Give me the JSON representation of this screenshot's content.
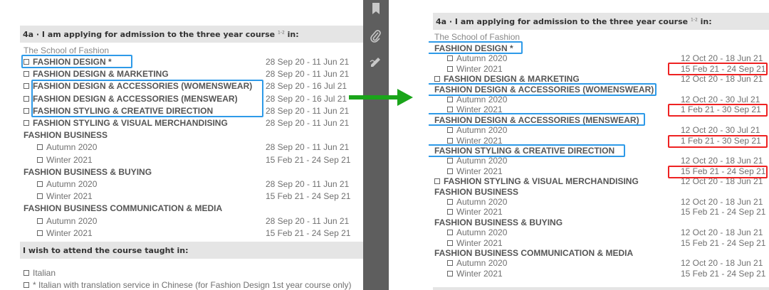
{
  "left": {
    "header": {
      "title": "4a · I am applying for admission to the three year course",
      "sup": "1-2",
      "suffix": " in:"
    },
    "school": "The School of Fashion",
    "rows": [
      {
        "text": "FASHION DESIGN *",
        "date": "28 Sep 20 - 11 Jun 21",
        "checkbox": true,
        "bold": true
      },
      {
        "text": "FASHION DESIGN & MARKETING",
        "date": "28 Sep 20 - 11 Jun 21",
        "checkbox": true,
        "bold": true
      },
      {
        "text": "FASHION DESIGN & ACCESSORIES (WOMENSWEAR)",
        "date": "28 Sep 20 - 16 Jul 21",
        "checkbox": true,
        "bold": true
      },
      {
        "text": "FASHION DESIGN & ACCESSORIES (MENSWEAR)",
        "date": "28 Sep 20 - 16 Jul 21",
        "checkbox": true,
        "bold": true
      },
      {
        "text": "FASHION STYLING & CREATIVE DIRECTION",
        "date": "28 Sep 20 - 11 Jun 21",
        "checkbox": true,
        "bold": true
      },
      {
        "text": "FASHION STYLING & VISUAL MERCHANDISING",
        "date": "28 Sep 20 - 11 Jun 21",
        "checkbox": true,
        "bold": true
      },
      {
        "text": "FASHION BUSINESS",
        "date": "",
        "checkbox": false,
        "bold": true
      },
      {
        "text": "Autumn 2020",
        "date": "28 Sep 20 - 11 Jun 21",
        "checkbox": true,
        "bold": false,
        "indent": true
      },
      {
        "text": "Winter 2021",
        "date": "15 Feb 21 - 24 Sep 21",
        "checkbox": true,
        "bold": false,
        "indent": true
      },
      {
        "text": "FASHION BUSINESS & BUYING",
        "date": "",
        "checkbox": false,
        "bold": true
      },
      {
        "text": "Autumn 2020",
        "date": "28 Sep 20 - 11 Jun 21",
        "checkbox": true,
        "bold": false,
        "indent": true
      },
      {
        "text": "Winter 2021",
        "date": "15 Feb 21 - 24 Sep 21",
        "checkbox": true,
        "bold": false,
        "indent": true
      },
      {
        "text": "FASHION BUSINESS COMMUNICATION & MEDIA",
        "date": "",
        "checkbox": false,
        "bold": true
      },
      {
        "text": "Autumn 2020",
        "date": "28 Sep 20 - 11 Jun 21",
        "checkbox": true,
        "bold": false,
        "indent": true
      },
      {
        "text": "Winter 2021",
        "date": "15 Feb 21 - 24 Sep 21",
        "checkbox": true,
        "bold": false,
        "indent": true
      }
    ],
    "header2": "I wish to attend the course taught in:",
    "options": [
      "Italian",
      "* Italian with translation service in Chinese (for Fashion Design 1st year course only)"
    ]
  },
  "right": {
    "header": {
      "title": "4a · I am applying for admission to the three year course",
      "sup": "1-2",
      "suffix": " in:"
    },
    "school": "The School of Fashion",
    "rows": [
      {
        "text": "FASHION DESIGN *",
        "date": "",
        "checkbox": false,
        "bold": true
      },
      {
        "text": "Autumn 2020",
        "date": "12 Oct 20 - 18 Jun 21",
        "checkbox": true,
        "bold": false,
        "indent": true
      },
      {
        "text": "Winter 2021",
        "date": "15 Feb 21 - 24 Sep 21",
        "checkbox": true,
        "bold": false,
        "indent": true
      },
      {
        "text": "FASHION DESIGN & MARKETING",
        "date": "12 Oct 20 - 18 Jun 21",
        "checkbox": true,
        "bold": true
      },
      {
        "text": "FASHION DESIGN & ACCESSORIES (WOMENSWEAR)",
        "date": "",
        "checkbox": false,
        "bold": true
      },
      {
        "text": "Autumn 2020",
        "date": "12 Oct 20 - 30 Jul 21",
        "checkbox": true,
        "bold": false,
        "indent": true
      },
      {
        "text": "Winter 2021",
        "date": "1 Feb 21 - 30 Sep 21",
        "checkbox": true,
        "bold": false,
        "indent": true
      },
      {
        "text": "FASHION DESIGN & ACCESSORIES (MENSWEAR)",
        "date": "",
        "checkbox": false,
        "bold": true
      },
      {
        "text": "Autumn 2020",
        "date": "12 Oct 20 - 30 Jul 21",
        "checkbox": true,
        "bold": false,
        "indent": true
      },
      {
        "text": "Winter 2021",
        "date": "1 Feb 21 - 30 Sep 21",
        "checkbox": true,
        "bold": false,
        "indent": true
      },
      {
        "text": "FASHION STYLING & CREATIVE DIRECTION",
        "date": "",
        "checkbox": false,
        "bold": true
      },
      {
        "text": "Autumn 2020",
        "date": "12 Oct 20 - 18 Jun 21",
        "checkbox": true,
        "bold": false,
        "indent": true
      },
      {
        "text": "Winter 2021",
        "date": "15 Feb 21 - 24 Sep 21",
        "checkbox": true,
        "bold": false,
        "indent": true
      },
      {
        "text": "FASHION STYLING & VISUAL MERCHANDISING",
        "date": "12 Oct 20 - 18 Jun 21",
        "checkbox": true,
        "bold": true
      },
      {
        "text": "FASHION BUSINESS",
        "date": "",
        "checkbox": false,
        "bold": true
      },
      {
        "text": "Autumn 2020",
        "date": "12 Oct 20 - 18 Jun 21",
        "checkbox": true,
        "bold": false,
        "indent": true
      },
      {
        "text": "Winter 2021",
        "date": "15 Feb 21 - 24 Sep 21",
        "checkbox": true,
        "bold": false,
        "indent": true
      },
      {
        "text": "FASHION BUSINESS & BUYING",
        "date": "",
        "checkbox": false,
        "bold": true
      },
      {
        "text": "Autumn 2020",
        "date": "12 Oct 20 - 18 Jun 21",
        "checkbox": true,
        "bold": false,
        "indent": true
      },
      {
        "text": "Winter 2021",
        "date": "15 Feb 21 - 24 Sep 21",
        "checkbox": true,
        "bold": false,
        "indent": true
      },
      {
        "text": "FASHION BUSINESS COMMUNICATION & MEDIA",
        "date": "",
        "checkbox": false,
        "bold": true
      },
      {
        "text": "Autumn 2020",
        "date": "12 Oct 20 - 18 Jun 21",
        "checkbox": true,
        "bold": false,
        "indent": true
      },
      {
        "text": "Winter 2021",
        "date": "15 Feb 21 - 24 Sep 21",
        "checkbox": true,
        "bold": false,
        "indent": true
      }
    ]
  },
  "toolbar": {
    "icons": [
      "bookmark-icon",
      "paperclip-icon",
      "sign-icon"
    ]
  },
  "colors": {
    "highlight_blue": "#2e9ae8",
    "highlight_red": "#e22222",
    "arrow_green": "#1aa51a",
    "toolbar_bg": "#5e5e5e"
  }
}
